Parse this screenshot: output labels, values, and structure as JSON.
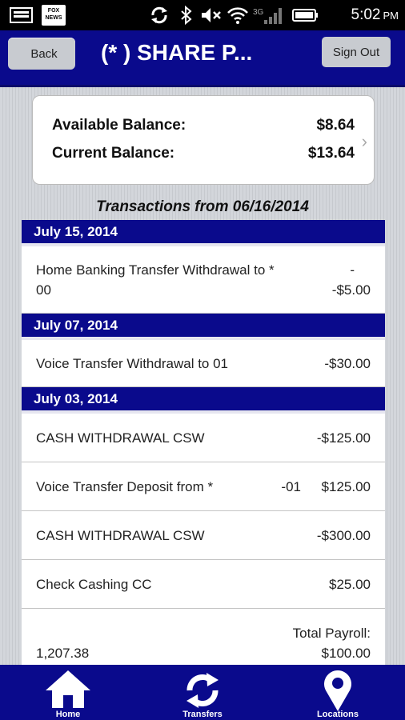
{
  "status_bar": {
    "time": "5:02",
    "ampm": "PM",
    "network": "3G",
    "notification_label": "FOX NEWS"
  },
  "header": {
    "back_label": "Back",
    "title": "(*        ) SHARE P...",
    "signout_label": "Sign Out"
  },
  "balance": {
    "available_label": "Available Balance:",
    "available_value": "$8.64",
    "current_label": "Current Balance:",
    "current_value": "$13.64"
  },
  "transactions_heading": "Transactions from 06/16/2014",
  "groups": [
    {
      "date": "July 15, 2014",
      "items": [
        {
          "desc_line1": "Home Banking Transfer Withdrawal to *",
          "desc_line2": "00",
          "extra": "-",
          "amount": "-$5.00"
        }
      ]
    },
    {
      "date": "July 07, 2014",
      "items": [
        {
          "desc": "Voice Transfer Withdrawal to 01",
          "amount": "-$30.00"
        }
      ]
    },
    {
      "date": "July 03, 2014",
      "items": [
        {
          "desc": "CASH WITHDRAWAL CSW",
          "amount": "-$125.00"
        },
        {
          "desc": "Voice Transfer Deposit from *",
          "extra": "-01",
          "amount": "$125.00"
        },
        {
          "desc": "CASH WITHDRAWAL CSW",
          "amount": "-$300.00"
        },
        {
          "desc": "Check Cashing CC",
          "amount": "$25.00"
        },
        {
          "desc_line2": "1,207.38",
          "label": "Total Payroll:",
          "amount": "$100.00"
        }
      ]
    }
  ],
  "bottom_nav": {
    "home": "Home",
    "transfers": "Transfers",
    "locations": "Locations"
  },
  "colors": {
    "header_bg": "#0a0a8c",
    "button_bg": "#c8cbd0"
  }
}
